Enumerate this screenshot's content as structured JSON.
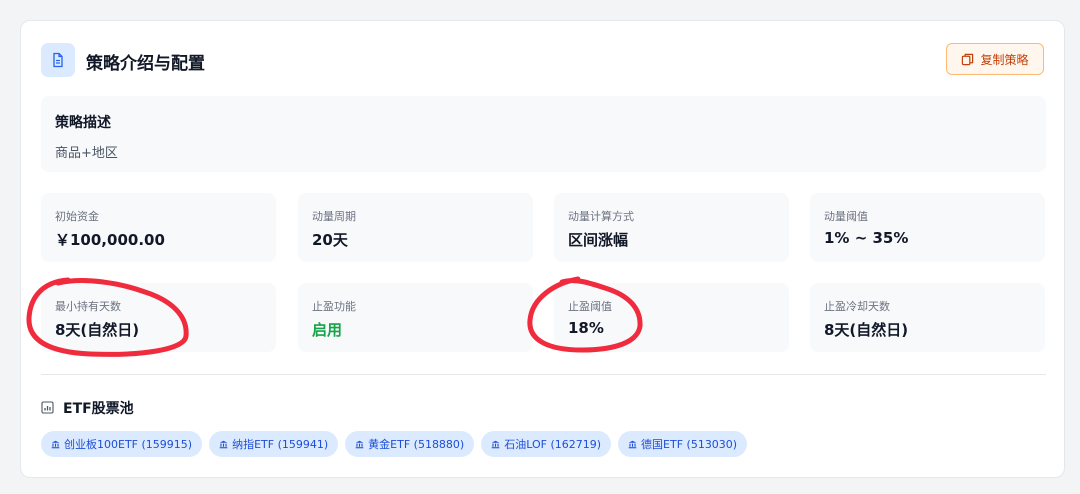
{
  "header": {
    "title": "策略介绍与配置",
    "copy_button": "复制策略"
  },
  "description": {
    "title": "策略描述",
    "text": "商品+地区"
  },
  "stats": [
    {
      "label": "初始资金",
      "value": "￥100,000.00"
    },
    {
      "label": "动量周期",
      "value": "20天"
    },
    {
      "label": "动量计算方式",
      "value": "区间涨幅"
    },
    {
      "label": "动量阈值",
      "value": "1% ~ 35%"
    },
    {
      "label": "最小持有天数",
      "value": "8天(自然日)"
    },
    {
      "label": "止盈功能",
      "value": "启用"
    },
    {
      "label": "止盈阈值",
      "value": "18%"
    },
    {
      "label": "止盈冷却天数",
      "value": "8天(自然日)"
    }
  ],
  "etf_pool": {
    "title": "ETF股票池",
    "items": [
      "创业板100ETF (159915)",
      "纳指ETF (159941)",
      "黄金ETF (518880)",
      "石油LOF (162719)",
      "德国ETF (513030)"
    ]
  },
  "colors": {
    "accent": "#2563eb",
    "enabled_green": "#16a34a",
    "copy_button_orange": "#c2410c",
    "annotation_red": "#ef2b3d"
  },
  "icons": {
    "header": "document-icon",
    "copy": "copy-icon",
    "etf": "chart-icon",
    "chip": "bank-icon"
  }
}
